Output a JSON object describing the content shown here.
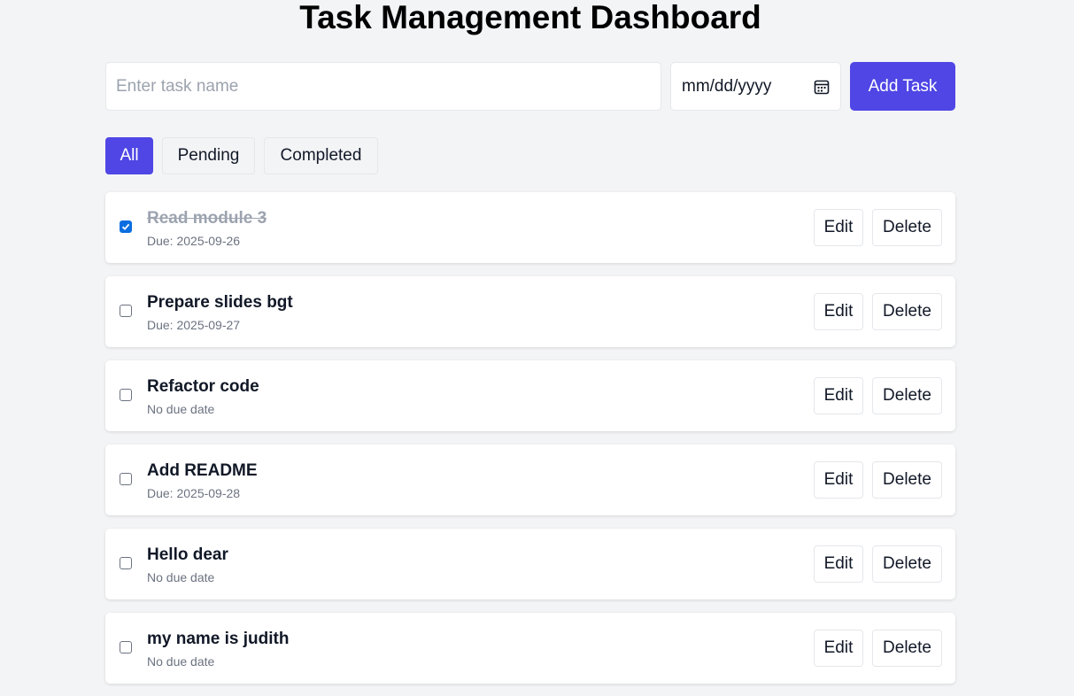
{
  "header": {
    "title": "Task Management Dashboard"
  },
  "form": {
    "task_placeholder": "Enter task name",
    "date_placeholder": "mm/dd/yyyy",
    "date_icon": "calendar-icon",
    "add_label": "Add Task"
  },
  "filters": {
    "all": "All",
    "pending": "Pending",
    "completed": "Completed",
    "active": "All"
  },
  "tasks": [
    {
      "name": "Read module 3",
      "due": "Due: 2025-09-26",
      "done": true,
      "edit": "Edit",
      "delete": "Delete"
    },
    {
      "name": "Prepare slides bgt",
      "due": "Due: 2025-09-27",
      "done": false,
      "edit": "Edit",
      "delete": "Delete"
    },
    {
      "name": "Refactor code",
      "due": "No due date",
      "done": false,
      "edit": "Edit",
      "delete": "Delete"
    },
    {
      "name": "Add README",
      "due": "Due: 2025-09-28",
      "done": false,
      "edit": "Edit",
      "delete": "Delete"
    },
    {
      "name": "Hello dear",
      "due": "No due date",
      "done": false,
      "edit": "Edit",
      "delete": "Delete"
    },
    {
      "name": "my name is judith",
      "due": "No due date",
      "done": false,
      "edit": "Edit",
      "delete": "Delete"
    }
  ],
  "colors": {
    "accent": "#4f46e5",
    "background": "#f3f4f6",
    "checkbox_checked": "#0b6ee0"
  }
}
